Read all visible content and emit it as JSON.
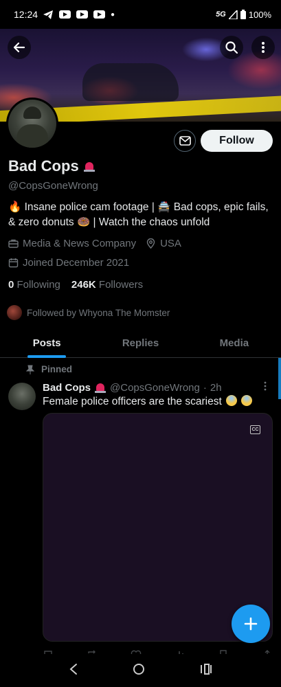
{
  "status_bar": {
    "time": "12:24",
    "network": "5G",
    "battery": "100%",
    "icons": [
      "telegram-icon",
      "youtube-icon",
      "youtube-icon",
      "youtube-icon",
      "dot-icon",
      "signal-icon",
      "battery-icon"
    ]
  },
  "header": {
    "back_icon": "arrow-left-icon",
    "search_icon": "search-icon",
    "more_icon": "more-vertical-icon"
  },
  "profile": {
    "display_name": "Bad Cops",
    "name_emoji": "siren-icon",
    "handle": "@CopsGoneWrong",
    "bio": "🔥 Insane police cam footage | 🚔 Bad cops, epic fails, & zero donuts 🍩 | Watch the chaos unfold",
    "category": "Media & News Company",
    "location": "USA",
    "joined": "Joined December 2021",
    "following_count": "0",
    "following_label": "Following",
    "followers_count": "246K",
    "followers_label": "Followers",
    "followed_by": "Followed by Whyona The Momster",
    "follow_label": "Follow"
  },
  "tabs": [
    {
      "label": "Posts",
      "active": true
    },
    {
      "label": "Replies",
      "active": false
    },
    {
      "label": "Media",
      "active": false
    }
  ],
  "post": {
    "pinned_label": "Pinned",
    "author_name": "Bad Cops",
    "author_handle": "@CopsGoneWrong",
    "separator": "·",
    "time": "2h",
    "text": "Female police officers are the scariest",
    "cc_label": "CC",
    "actions": [
      "reply-icon",
      "repost-icon",
      "like-icon",
      "views-icon",
      "bookmark-icon",
      "share-icon"
    ]
  },
  "colors": {
    "accent": "#1d9bf0",
    "background": "#000000",
    "text_primary": "#e7e9ea",
    "text_secondary": "#71767b"
  }
}
